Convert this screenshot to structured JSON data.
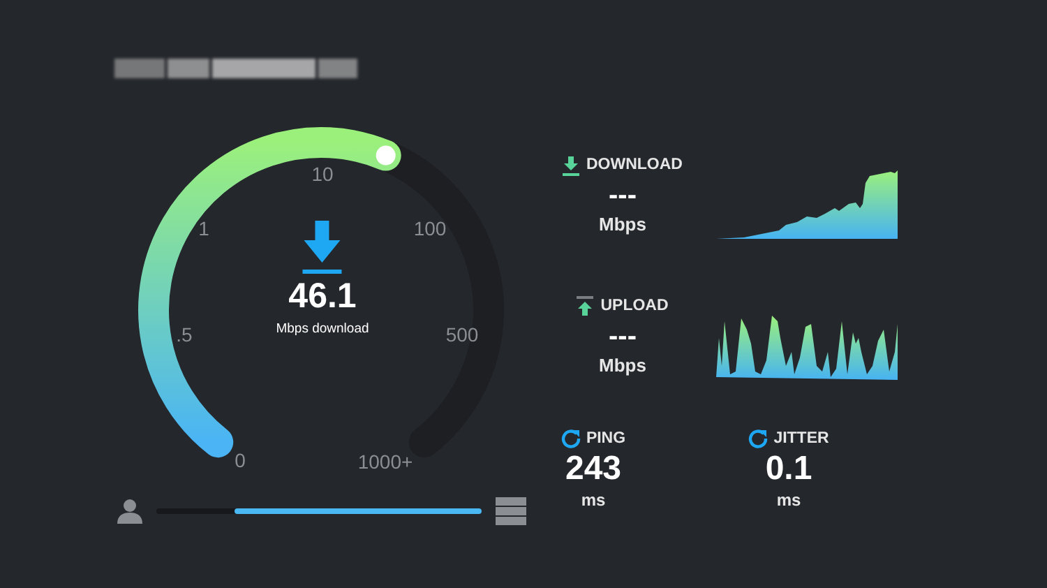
{
  "gauge": {
    "labels": [
      "0",
      ".5",
      "1",
      "10",
      "100",
      "500",
      "1000+"
    ],
    "value": "46.1",
    "caption": "Mbps download"
  },
  "progress": {
    "level": 0.76
  },
  "metrics": [
    {
      "kind": "download",
      "title": "DOWNLOAD",
      "value": "---",
      "unit": "Mbps"
    },
    {
      "kind": "upload",
      "title": "UPLOAD",
      "value": "---",
      "unit": "Mbps"
    }
  ],
  "latency": [
    {
      "title": "PING",
      "value": "243",
      "unit": "ms"
    },
    {
      "title": "JITTER",
      "value": "0.1",
      "unit": "ms"
    }
  ]
}
